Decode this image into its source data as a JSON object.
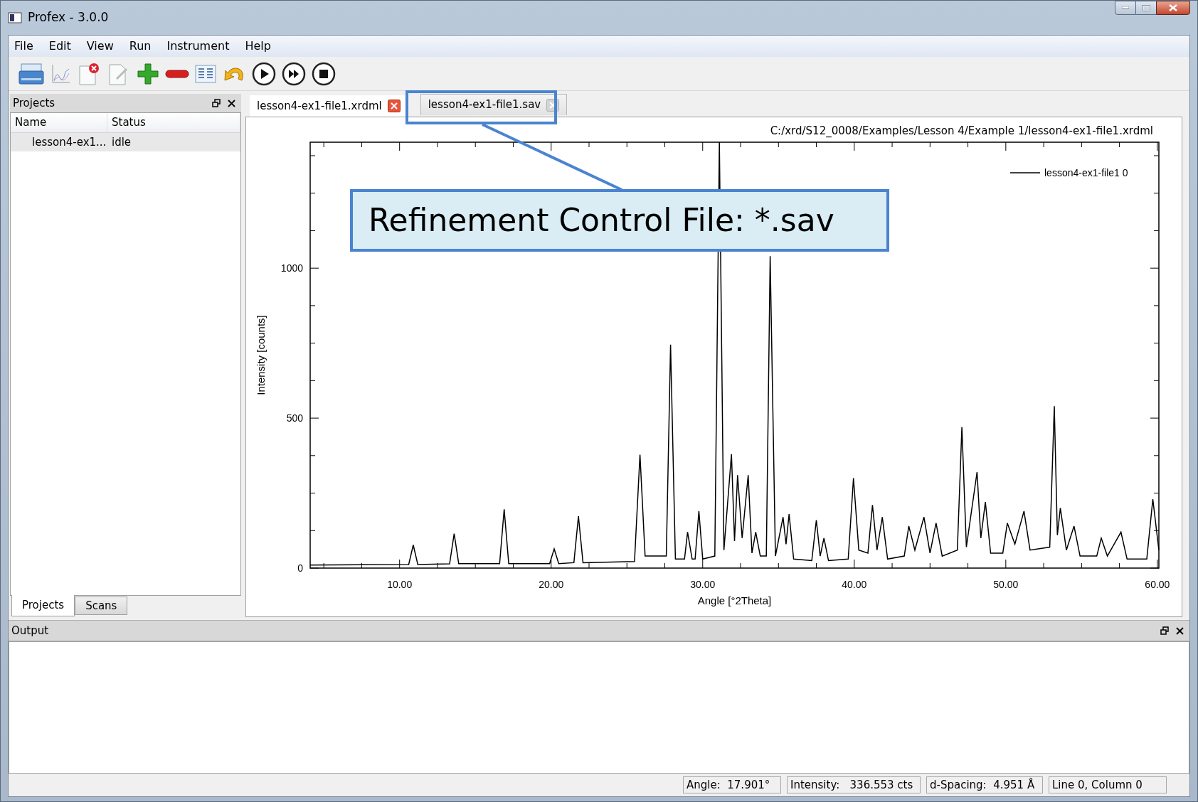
{
  "window": {
    "title": "Profex - 3.0.0"
  },
  "menu": [
    "File",
    "Edit",
    "View",
    "Run",
    "Instrument",
    "Help"
  ],
  "projects_panel": {
    "title": "Projects",
    "columns": [
      "Name",
      "Status"
    ],
    "rows": [
      {
        "cells": [
          "lesson4-ex1...",
          "idle"
        ],
        "selected": true
      }
    ],
    "tabs": [
      {
        "label": "Projects",
        "selected": true
      },
      {
        "label": "Scans",
        "selected": false
      }
    ]
  },
  "document_tabs": [
    {
      "label": "lesson4-ex1-file1.xrdml",
      "selected": true
    },
    {
      "label": "lesson4-ex1-file1.sav",
      "selected": false
    }
  ],
  "file_path": "C:/xrd/S12_0008/Examples/Lesson 4/Example 1/lesson4-ex1-file1.xrdml",
  "chart_data": {
    "type": "line",
    "xlabel": "Angle [°2Theta]",
    "ylabel": "Intensity [counts]",
    "xlim": [
      4.1,
      60.1
    ],
    "ylim": [
      0,
      1420
    ],
    "xticks": [
      {
        "value": 10,
        "label": "10.00"
      },
      {
        "value": 20,
        "label": "20.00"
      },
      {
        "value": 30,
        "label": "30.00"
      },
      {
        "value": 40,
        "label": "40.00"
      },
      {
        "value": 50,
        "label": "50.00"
      },
      {
        "value": 60,
        "label": "60.00"
      }
    ],
    "yticks": [
      0,
      500,
      1000
    ],
    "x": [
      4.1,
      10.6,
      10.9,
      11.2,
      13.3,
      13.6,
      13.9,
      16.6,
      16.9,
      17.2,
      19.9,
      20.2,
      20.5,
      21.5,
      21.8,
      22.1,
      25.5,
      25.86,
      26.2,
      27.6,
      27.88,
      28.2,
      28.8,
      29.0,
      29.3,
      29.5,
      29.75,
      30.0,
      30.8,
      31.1,
      31.4,
      31.9,
      32.1,
      32.3,
      32.6,
      33.0,
      33.25,
      33.5,
      33.8,
      34.2,
      34.45,
      34.8,
      35.3,
      35.5,
      35.7,
      36.0,
      37.2,
      37.5,
      37.75,
      38.0,
      38.3,
      39.6,
      39.95,
      40.3,
      40.9,
      41.2,
      41.5,
      41.85,
      42.2,
      43.3,
      43.6,
      44.0,
      44.6,
      45.0,
      45.4,
      45.8,
      46.8,
      47.1,
      47.4,
      48.1,
      48.35,
      48.65,
      49.0,
      49.8,
      50.1,
      50.6,
      51.2,
      51.6,
      52.9,
      53.2,
      53.4,
      53.6,
      54.0,
      54.5,
      54.9,
      56.0,
      56.3,
      56.7,
      57.6,
      58.0,
      59.3,
      59.7,
      60.1
    ],
    "series": [
      {
        "name": "lesson4-ex1-file1 0",
        "color": "#000000",
        "values": [
          10,
          12,
          77,
          12,
          14,
          115,
          15,
          15,
          196,
          15,
          15,
          64,
          15,
          18,
          173,
          18,
          22,
          378,
          40,
          40,
          745,
          30,
          30,
          120,
          30,
          30,
          190,
          30,
          40,
          1420,
          60,
          380,
          90,
          310,
          100,
          310,
          50,
          120,
          40,
          40,
          1040,
          40,
          170,
          80,
          180,
          30,
          25,
          160,
          40,
          100,
          25,
          30,
          300,
          60,
          50,
          210,
          60,
          170,
          30,
          40,
          140,
          60,
          170,
          50,
          150,
          40,
          60,
          470,
          70,
          320,
          100,
          220,
          50,
          50,
          150,
          80,
          190,
          60,
          70,
          540,
          110,
          200,
          60,
          140,
          40,
          40,
          100,
          40,
          120,
          30,
          30,
          230,
          60
        ]
      }
    ]
  },
  "output_panel": {
    "title": "Output"
  },
  "status_bar": [
    "Angle:  17.901°",
    "Intensity:   336.553 cts",
    "d-Spacing:  4.951 Å",
    "Line 0, Column 0"
  ],
  "callout": {
    "text": "Refinement Control File: *.sav"
  }
}
